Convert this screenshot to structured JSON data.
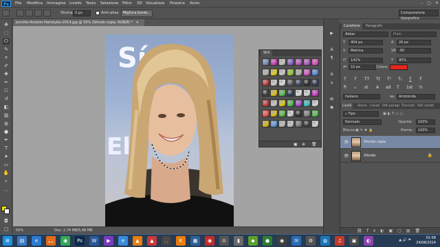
{
  "app": {
    "logo": "Ps"
  },
  "menu": [
    "File",
    "Modifica",
    "Immagine",
    "Livello",
    "Testo",
    "Selezione",
    "Filtro",
    "3D",
    "Visualizza",
    "Finestra",
    "Aiuto"
  ],
  "window_controls": [
    "–",
    "▢",
    "✕"
  ],
  "options": {
    "feather_label": "Sfuma:",
    "feather_value": "0 px",
    "antialias_label": "Anti-alias",
    "refine_label": "Migliora bordo...",
    "workspace": "Composizione tipografica"
  },
  "document": {
    "tab_title": "Jennifer-Aniston-Hairstyles-2014.jpg @ 50% (Sfondo copia, RGB/8) *",
    "tab_close": "×",
    "zoom": "50%",
    "doc_size": "Doc: 2,74 MB/5,48 MB",
    "bg_text_top": "Sí",
    "bg_text_side": "El"
  },
  "stili_panel": {
    "title": "Stili",
    "swatches": [
      "#7a8fc0",
      "#d63cbf",
      "#c7c7c7",
      "#8d62c8",
      "#c458c2",
      "#b55bc6",
      "#e24fc4",
      "#b8b8b8",
      "#f0d21a",
      "#c9c9c9",
      "#98cf2e",
      "#b0b0b0",
      "#d55bd0",
      "#5b87d7",
      "#c63a3a",
      "#cfcfcf",
      "#e0e0e0",
      "#5c5c5c",
      "#3a4a62",
      "#2a2a2a",
      "#2f3e58",
      "#3a3a3a",
      "#e3c21b",
      "#54c24e",
      "#2c3a52",
      "#e0e0e0",
      "#d9d9d9",
      "#d23bcb",
      "#c93a3a",
      "#c9c9c9",
      "#e2c91c",
      "#54c24e",
      "#a84ed0",
      "#3ac2c2",
      "#d7d7d7",
      "#ff5050",
      "#d7c11b",
      "#5cc24f",
      "#d8d8d8",
      "#2f2f2f",
      "#888888",
      "#52c44c",
      "#e2b81c",
      "#59a1e6",
      "#bfbfbf",
      "#c7c7c7",
      "#7c7c7c",
      "#3b3b3b",
      "#d7d7d7"
    ],
    "footer_icons": [
      "▣",
      "⊕",
      "🗑"
    ]
  },
  "right_strip_icons": [
    "▶",
    "A",
    "¶",
    "A",
    "⌂",
    "⊞",
    "◉"
  ],
  "character": {
    "tabs": [
      "Carattere",
      "Paragrafo"
    ],
    "font_family": "Akbar",
    "font_style": "Plain",
    "size": "404 px",
    "leading": "26 px",
    "kerning": "Metrica",
    "tracking": "-90",
    "vscale": "142%",
    "hscale": "95%",
    "baseline": "10 px",
    "color_label": "Colore:",
    "color": "#e8251f",
    "format_buttons": [
      "T",
      "T",
      "TT",
      "Tt",
      "T¹",
      "T₁",
      "T",
      "Ŧ"
    ],
    "opentype": [
      "fi",
      "ℴ",
      "st",
      "A",
      "ad",
      "T",
      "1st",
      "½"
    ],
    "language": "Italiano",
    "aa_mode": "Arrotonda"
  },
  "layers": {
    "tabs": [
      "Livelli",
      "Storia",
      "Canali",
      "Stili paragr.",
      "Tracciati",
      "Stili caratt."
    ],
    "filter_label": "Tipo",
    "blend_mode": "Normale",
    "opacity_label": "Opacità:",
    "opacity": "100%",
    "lock_label": "Blocca:",
    "fill_label": "Riemp.:",
    "fill": "100%",
    "items": [
      {
        "name": "Sfondo copia",
        "selected": true,
        "locked": false
      },
      {
        "name": "Sfondo",
        "selected": false,
        "locked": true
      }
    ]
  },
  "taskbar": {
    "apps": [
      {
        "label": "⊞",
        "color": "#1f8fdc"
      },
      {
        "label": "▤",
        "color": "#3a7ac2"
      },
      {
        "label": "e",
        "color": "#2d7ad1"
      },
      {
        "label": "🦊",
        "color": "#e06b17"
      },
      {
        "label": "◉",
        "color": "#35a853"
      },
      {
        "label": "Ps",
        "color": "#0b2a4a"
      },
      {
        "label": "W",
        "color": "#2b579a"
      },
      {
        "label": "▶",
        "color": "#7a3bbf"
      },
      {
        "label": "e",
        "color": "#3a8bdc"
      },
      {
        "label": "▲",
        "color": "#e87d0d"
      },
      {
        "label": "▲",
        "color": "#c63a3a"
      },
      {
        "label": "🎧",
        "color": "#444444"
      },
      {
        "label": "K",
        "color": "#e87d0d"
      },
      {
        "label": "▦",
        "color": "#2f5f9a"
      },
      {
        "label": "◉",
        "color": "#c42b2b"
      },
      {
        "label": "⊙",
        "color": "#555555"
      },
      {
        "label": "▮",
        "color": "#6a6a6a"
      },
      {
        "label": "◆",
        "color": "#5aa02c"
      },
      {
        "label": "●",
        "color": "#2e7d32"
      },
      {
        "label": "◉",
        "color": "#3e3e3e"
      },
      {
        "label": "✉",
        "color": "#2a6bb0"
      },
      {
        "label": "⚙",
        "color": "#555555"
      },
      {
        "label": "◍",
        "color": "#1c75bc"
      },
      {
        "label": "♫",
        "color": "#c0392b"
      },
      {
        "label": "▣",
        "color": "#4a4a4a"
      },
      {
        "label": "◐",
        "color": "#8e44ad"
      }
    ],
    "time": "01:58",
    "date": "24/08/2014"
  }
}
